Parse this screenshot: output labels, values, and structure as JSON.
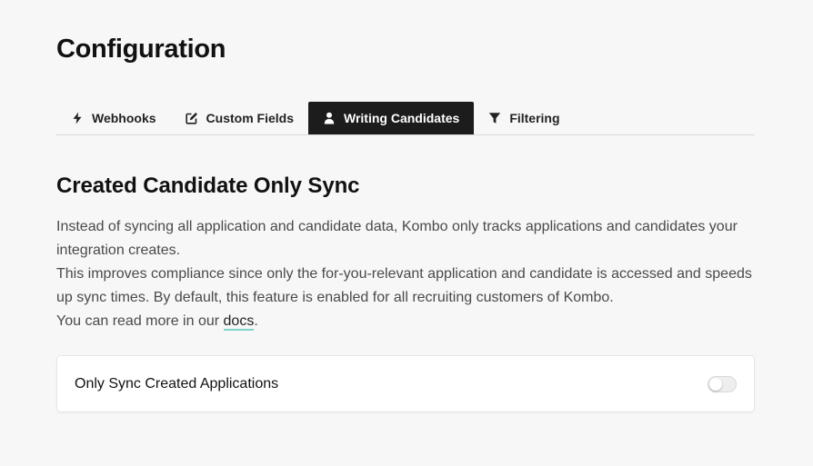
{
  "page": {
    "title": "Configuration"
  },
  "tabs": [
    {
      "label": "Webhooks",
      "icon": "bolt-icon",
      "active": false
    },
    {
      "label": "Custom Fields",
      "icon": "edit-icon",
      "active": false
    },
    {
      "label": "Writing Candidates",
      "icon": "user-icon",
      "active": true
    },
    {
      "label": "Filtering",
      "icon": "filter-icon",
      "active": false
    }
  ],
  "section": {
    "title": "Created Candidate Only Sync",
    "paragraph_1": "Instead of syncing all application and candidate data, Kombo only tracks applications and candidates your integration creates.",
    "paragraph_2": "This improves compliance since only the for-you-relevant application and candidate is accessed and speeds up sync times. By default, this feature is enabled for all recruiting customers of Kombo.",
    "paragraph_3_prefix": "You can read more in our ",
    "docs_link_label": "docs",
    "paragraph_3_suffix": "."
  },
  "setting": {
    "label": "Only Sync Created Applications",
    "toggle_on": false
  },
  "colors": {
    "background": "#f7f7f7",
    "active_tab_bg": "#1c1c1c",
    "link_underline": "#7fd3c9"
  }
}
